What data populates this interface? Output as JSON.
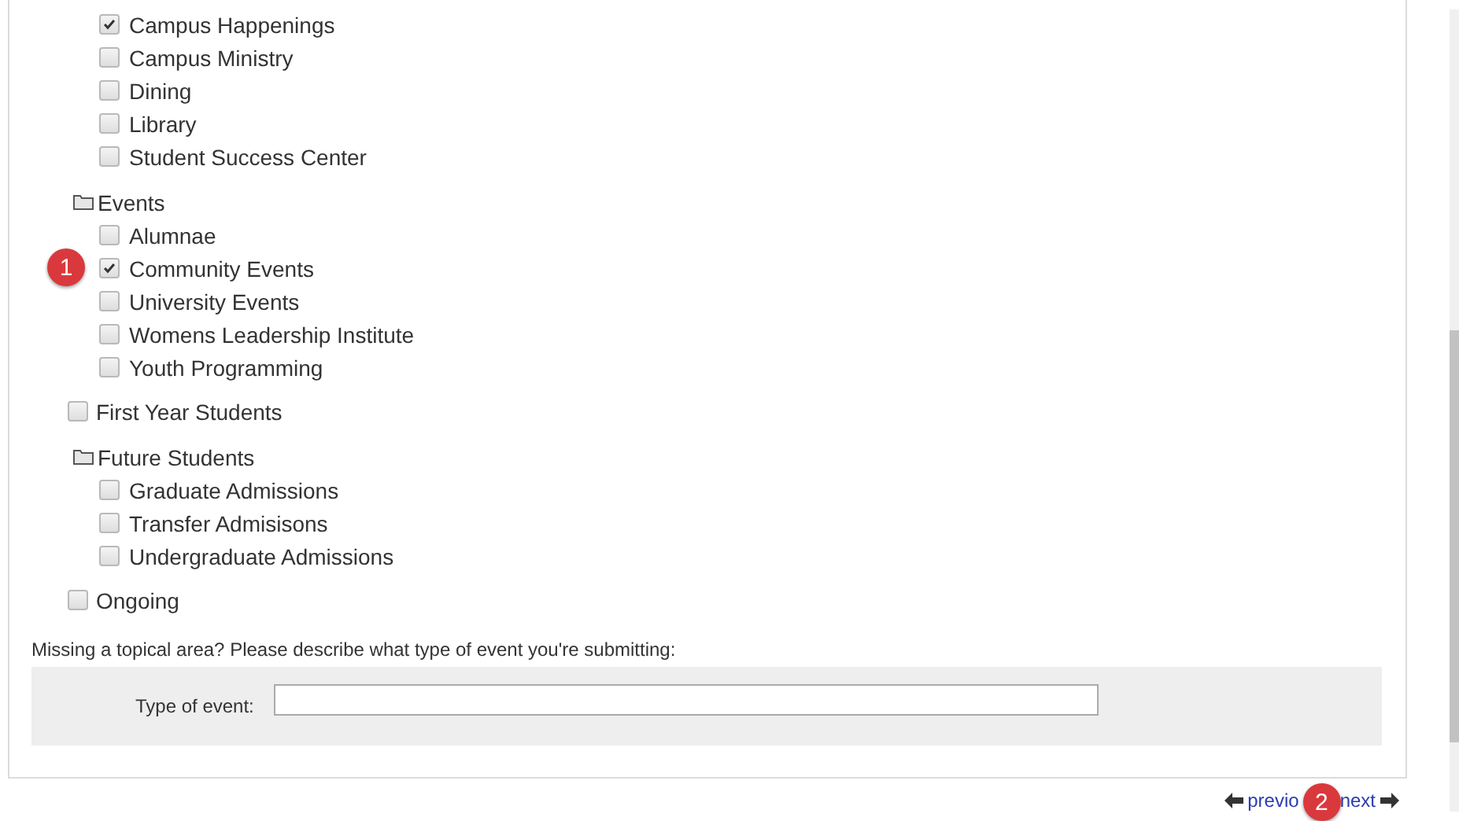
{
  "tree": [
    {
      "kind": "continued",
      "children": [
        {
          "kind": "checkbox",
          "label": "Campus Happenings",
          "checked": true
        },
        {
          "kind": "checkbox",
          "label": "Campus Ministry",
          "checked": false
        },
        {
          "kind": "checkbox",
          "label": "Dining",
          "checked": false
        },
        {
          "kind": "checkbox",
          "label": "Library",
          "checked": false
        },
        {
          "kind": "checkbox",
          "label": "Student Success Center",
          "checked": false
        }
      ]
    },
    {
      "kind": "folder",
      "label": "Events",
      "children": [
        {
          "kind": "checkbox",
          "label": "Alumnae",
          "checked": false
        },
        {
          "kind": "checkbox",
          "label": "Community Events",
          "checked": true,
          "badge": "1"
        },
        {
          "kind": "checkbox",
          "label": "University Events",
          "checked": false
        },
        {
          "kind": "checkbox",
          "label": "Womens Leadership Institute",
          "checked": false
        },
        {
          "kind": "checkbox",
          "label": "Youth Programming",
          "checked": false
        }
      ]
    },
    {
      "kind": "checkbox",
      "label": "First Year Students",
      "checked": false
    },
    {
      "kind": "folder",
      "label": "Future Students",
      "children": [
        {
          "kind": "checkbox",
          "label": "Graduate Admissions",
          "checked": false
        },
        {
          "kind": "checkbox",
          "label": "Transfer Admisisons",
          "checked": false
        },
        {
          "kind": "checkbox",
          "label": "Undergraduate Admissions",
          "checked": false
        }
      ]
    },
    {
      "kind": "checkbox",
      "label": "Ongoing",
      "checked": false
    }
  ],
  "missing_prompt": "Missing a topical area? Please describe what type of event you're submitting:",
  "type_field": {
    "label": "Type of event:"
  },
  "nav": {
    "previous": "previo",
    "badge": "2",
    "next": "next"
  }
}
